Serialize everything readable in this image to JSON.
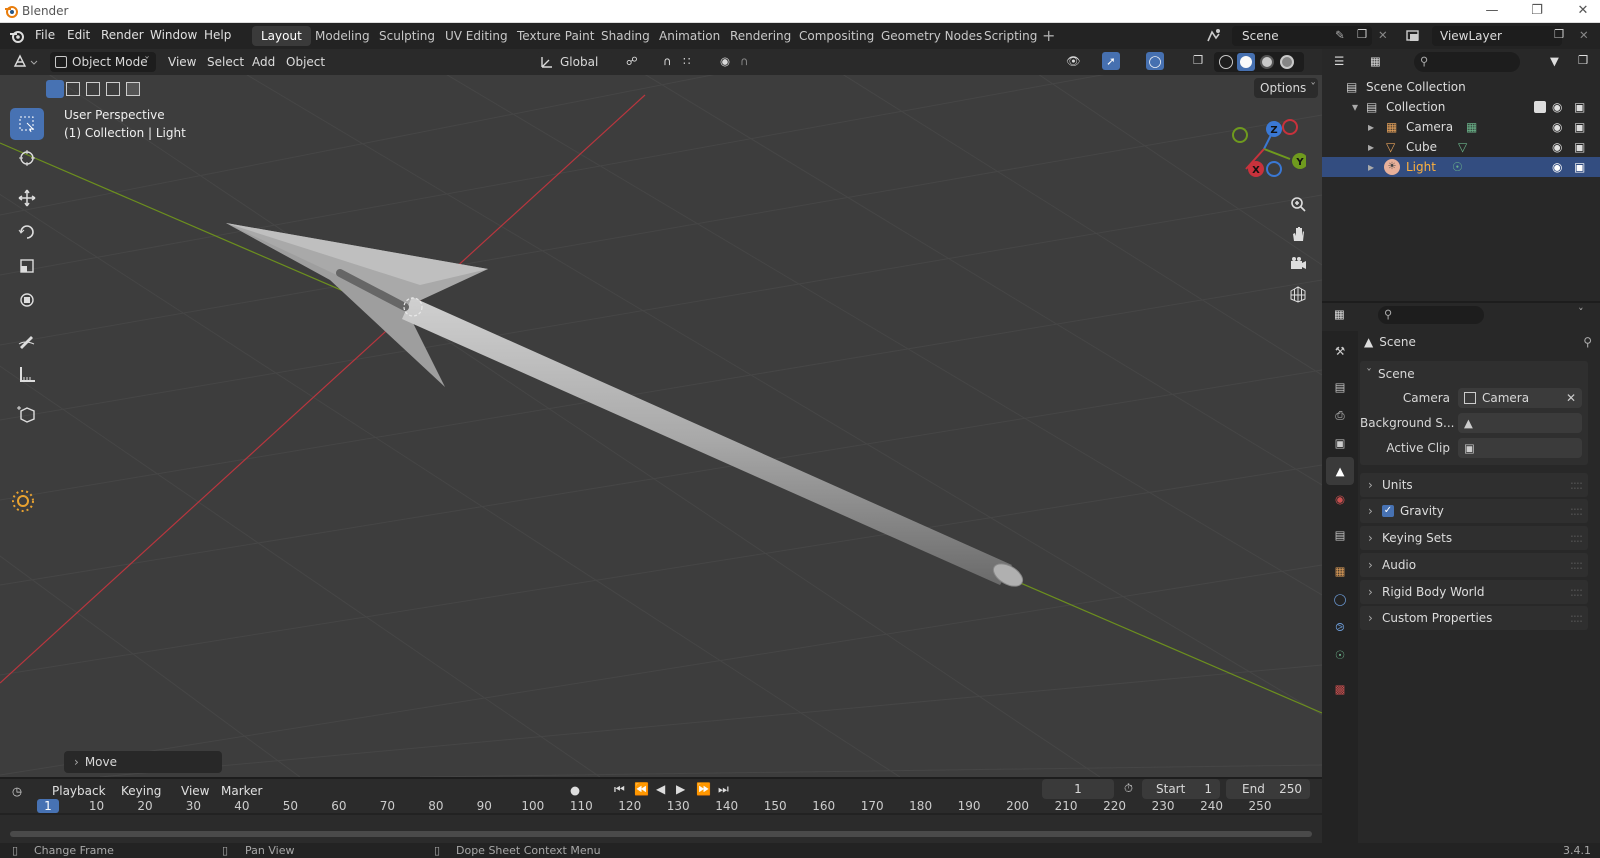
{
  "window": {
    "title": "Blender",
    "version": "3.4.1"
  },
  "menu": [
    "File",
    "Edit",
    "Render",
    "Window",
    "Help"
  ],
  "workspaces": [
    {
      "label": "Layout",
      "active": true
    },
    {
      "label": "Modeling"
    },
    {
      "label": "Sculpting"
    },
    {
      "label": "UV Editing"
    },
    {
      "label": "Texture Paint"
    },
    {
      "label": "Shading"
    },
    {
      "label": "Animation"
    },
    {
      "label": "Rendering"
    },
    {
      "label": "Compositing"
    },
    {
      "label": "Geometry Nodes"
    },
    {
      "label": "Scripting"
    }
  ],
  "scene_selector": {
    "value": "Scene"
  },
  "viewlayer_selector": {
    "value": "ViewLayer"
  },
  "viewport_header": {
    "mode": "Object Mode",
    "menus": [
      "View",
      "Select",
      "Add",
      "Object"
    ],
    "transform_orientation": "Global",
    "options_label": "Options"
  },
  "viewport": {
    "perspective_label": "User Perspective",
    "context_label": "(1) Collection | Light",
    "last_operator": "Move",
    "gizmo": {
      "x": "X",
      "y": "Y",
      "z": "Z"
    }
  },
  "outliner": {
    "root": "Scene Collection",
    "collection": "Collection",
    "items": [
      {
        "label": "Camera",
        "selected": false
      },
      {
        "label": "Cube",
        "selected": false
      },
      {
        "label": "Light",
        "selected": true
      }
    ]
  },
  "properties": {
    "context_title": "Scene",
    "section_title": "Scene",
    "fields": [
      {
        "label": "Camera",
        "value": "Camera"
      },
      {
        "label": "Background S...",
        "value": ""
      },
      {
        "label": "Active Clip",
        "value": ""
      }
    ],
    "panels": [
      {
        "label": "Units",
        "checkbox": false
      },
      {
        "label": "Gravity",
        "checkbox": true
      },
      {
        "label": "Keying Sets",
        "checkbox": false
      },
      {
        "label": "Audio",
        "checkbox": false
      },
      {
        "label": "Rigid Body World",
        "checkbox": false
      },
      {
        "label": "Custom Properties",
        "checkbox": false
      }
    ]
  },
  "timeline": {
    "menus": [
      "Playback",
      "Keying",
      "View",
      "Marker"
    ],
    "current_frame": "1",
    "start_label": "Start",
    "start": "1",
    "end_label": "End",
    "end": "250",
    "ticks": [
      "1",
      "10",
      "20",
      "30",
      "40",
      "50",
      "60",
      "70",
      "80",
      "90",
      "100",
      "110",
      "120",
      "130",
      "140",
      "150",
      "160",
      "170",
      "180",
      "190",
      "200",
      "210",
      "220",
      "230",
      "240",
      "250"
    ]
  },
  "status": {
    "left": "Change Frame",
    "middle": "Pan View",
    "right": "Dope Sheet Context Menu"
  },
  "colors": {
    "accent": "#4772b3",
    "x_axis": "#c8323c",
    "y_axis": "#6f9a1e",
    "z_axis": "#3a78d4",
    "viewport_bg": "#3d3d3d"
  }
}
